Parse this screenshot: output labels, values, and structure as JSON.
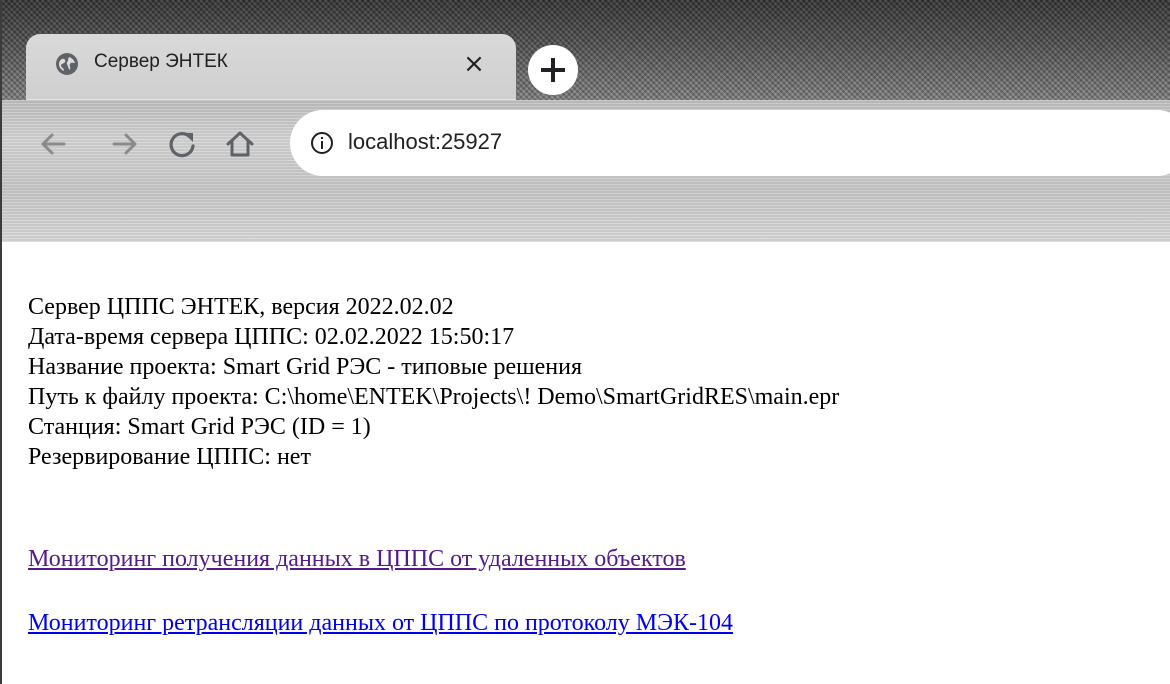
{
  "browser": {
    "tab": {
      "title": "Сервер ЭНТЕК",
      "close_glyph": "×",
      "favicon": "globe-icon"
    },
    "new_tab_icon": "plus-icon",
    "nav": {
      "back_icon": "arrow-left-icon",
      "forward_icon": "arrow-right-icon",
      "reload_icon": "reload-icon",
      "home_icon": "home-icon"
    },
    "address": {
      "security_icon": "info-icon",
      "url": "localhost:25927"
    },
    "colors": {
      "tab_bg": "#d9d9d9",
      "omnibox_bg": "#ffffff",
      "icon": "#5f6368"
    }
  },
  "page": {
    "info_lines": [
      "Сервер ЦППС ЭНТЕК, версия 2022.02.02",
      "Дата-время сервера ЦППС: 02.02.2022 15:50:17",
      "Название проекта: Smart Grid РЭС - типовые решения",
      "Путь к файлу проекта: C:\\home\\ENTEK\\Projects\\! Demo\\SmartGridRES\\main.epr",
      "Станция: Smart Grid РЭС (ID = 1)",
      "Резервирование ЦППС: нет"
    ],
    "links": [
      "Мониторинг получения данных в ЦППС от удаленных объектов",
      "Мониторинг ретрансляции данных от ЦППС по протоколу МЭК-104"
    ],
    "colors": {
      "text": "#000000",
      "link": "#0000ee",
      "link_visited": "#551a8b"
    }
  }
}
